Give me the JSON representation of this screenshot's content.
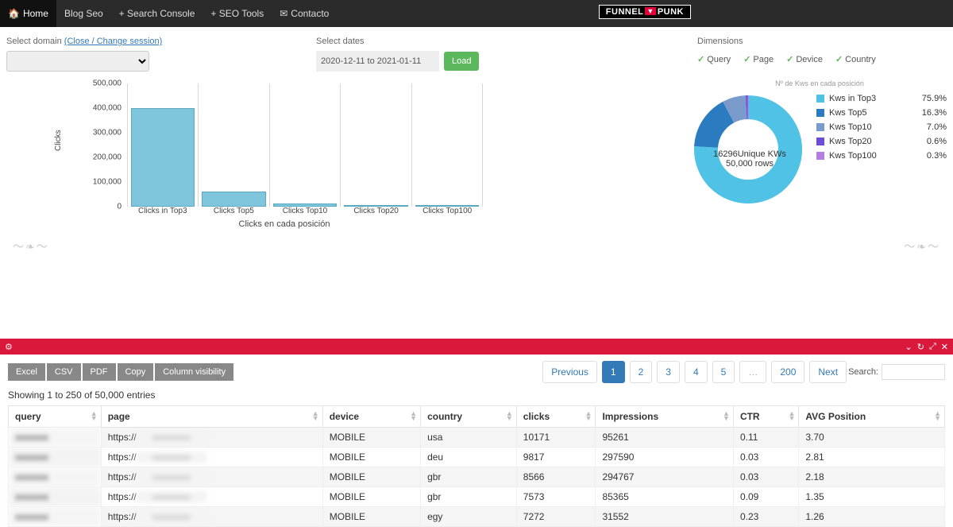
{
  "nav": {
    "items": [
      {
        "label": "Home",
        "icon": "🏠",
        "active": true
      },
      {
        "label": "Blog Seo"
      },
      {
        "label": "+ Search Console"
      },
      {
        "label": "+ SEO Tools"
      },
      {
        "label": "Contacto",
        "icon": "✉"
      }
    ],
    "brand_a": "FUNNEL",
    "brand_b": "▼",
    "brand_c": "PUNK"
  },
  "filters": {
    "domain_label": "Select domain",
    "close_link": "(Close / Change session)",
    "dates_label": "Select dates",
    "date_range": "2020-12-11 to 2021-01-11",
    "load_btn": "Load",
    "dims_label": "Dimensions",
    "dims": [
      "Query",
      "Page",
      "Device",
      "Country"
    ]
  },
  "chart_data": {
    "type": "bar",
    "title": "",
    "xlabel": "Clicks en cada posición",
    "ylabel": "Clicks",
    "ylim": [
      0,
      500000
    ],
    "yticks": [
      "0",
      "100,000",
      "200,000",
      "300,000",
      "400,000",
      "500,000"
    ],
    "categories": [
      "Clicks in Top3",
      "Clicks Top5",
      "Clicks Top10",
      "Clicks Top20",
      "Clicks Top100"
    ],
    "values": [
      400000,
      60000,
      12000,
      1000,
      500
    ]
  },
  "donut": {
    "title": "Nº de Kws en cada posición",
    "center_line1": "16296Unique KWs",
    "center_line2": "50,000 rows",
    "series": [
      {
        "name": "Kws in Top3",
        "pct": "75.9%",
        "value": 75.9,
        "color": "#4fc2e5"
      },
      {
        "name": "Kws Top5",
        "pct": "16.3%",
        "value": 16.3,
        "color": "#2a7bbf"
      },
      {
        "name": "Kws Top10",
        "pct": "7.0%",
        "value": 7.0,
        "color": "#7a9acb"
      },
      {
        "name": "Kws Top20",
        "pct": "0.6%",
        "value": 0.6,
        "color": "#6f4cd8"
      },
      {
        "name": "Kws Top100",
        "pct": "0.3%",
        "value": 0.3,
        "color": "#b57be0"
      }
    ]
  },
  "table": {
    "buttons": [
      "Excel",
      "CSV",
      "PDF",
      "Copy",
      "Column visibility"
    ],
    "search_label": "Search:",
    "entries_info": "Showing 1 to 250 of 50,000 entries",
    "pager": {
      "prev": "Previous",
      "pages": [
        "1",
        "2",
        "3",
        "4",
        "5",
        "…",
        "200"
      ],
      "active": "1",
      "next": "Next"
    },
    "columns": [
      "query",
      "page",
      "device",
      "country",
      "clicks",
      "Impressions",
      "CTR",
      "AVG Position"
    ],
    "rows": [
      {
        "query": "",
        "page": "https://",
        "device": "MOBILE",
        "country": "usa",
        "clicks": "10171",
        "impressions": "95261",
        "ctr": "0.11",
        "avg": "3.70"
      },
      {
        "query": "",
        "page": "https://",
        "device": "MOBILE",
        "country": "deu",
        "clicks": "9817",
        "impressions": "297590",
        "ctr": "0.03",
        "avg": "2.81"
      },
      {
        "query": "",
        "page": "https://",
        "device": "MOBILE",
        "country": "gbr",
        "clicks": "8566",
        "impressions": "294767",
        "ctr": "0.03",
        "avg": "2.18"
      },
      {
        "query": "",
        "page": "https://",
        "device": "MOBILE",
        "country": "gbr",
        "clicks": "7573",
        "impressions": "85365",
        "ctr": "0.09",
        "avg": "1.35"
      },
      {
        "query": "",
        "page": "https://",
        "device": "MOBILE",
        "country": "egy",
        "clicks": "7272",
        "impressions": "31552",
        "ctr": "0.23",
        "avg": "1.26"
      }
    ]
  }
}
